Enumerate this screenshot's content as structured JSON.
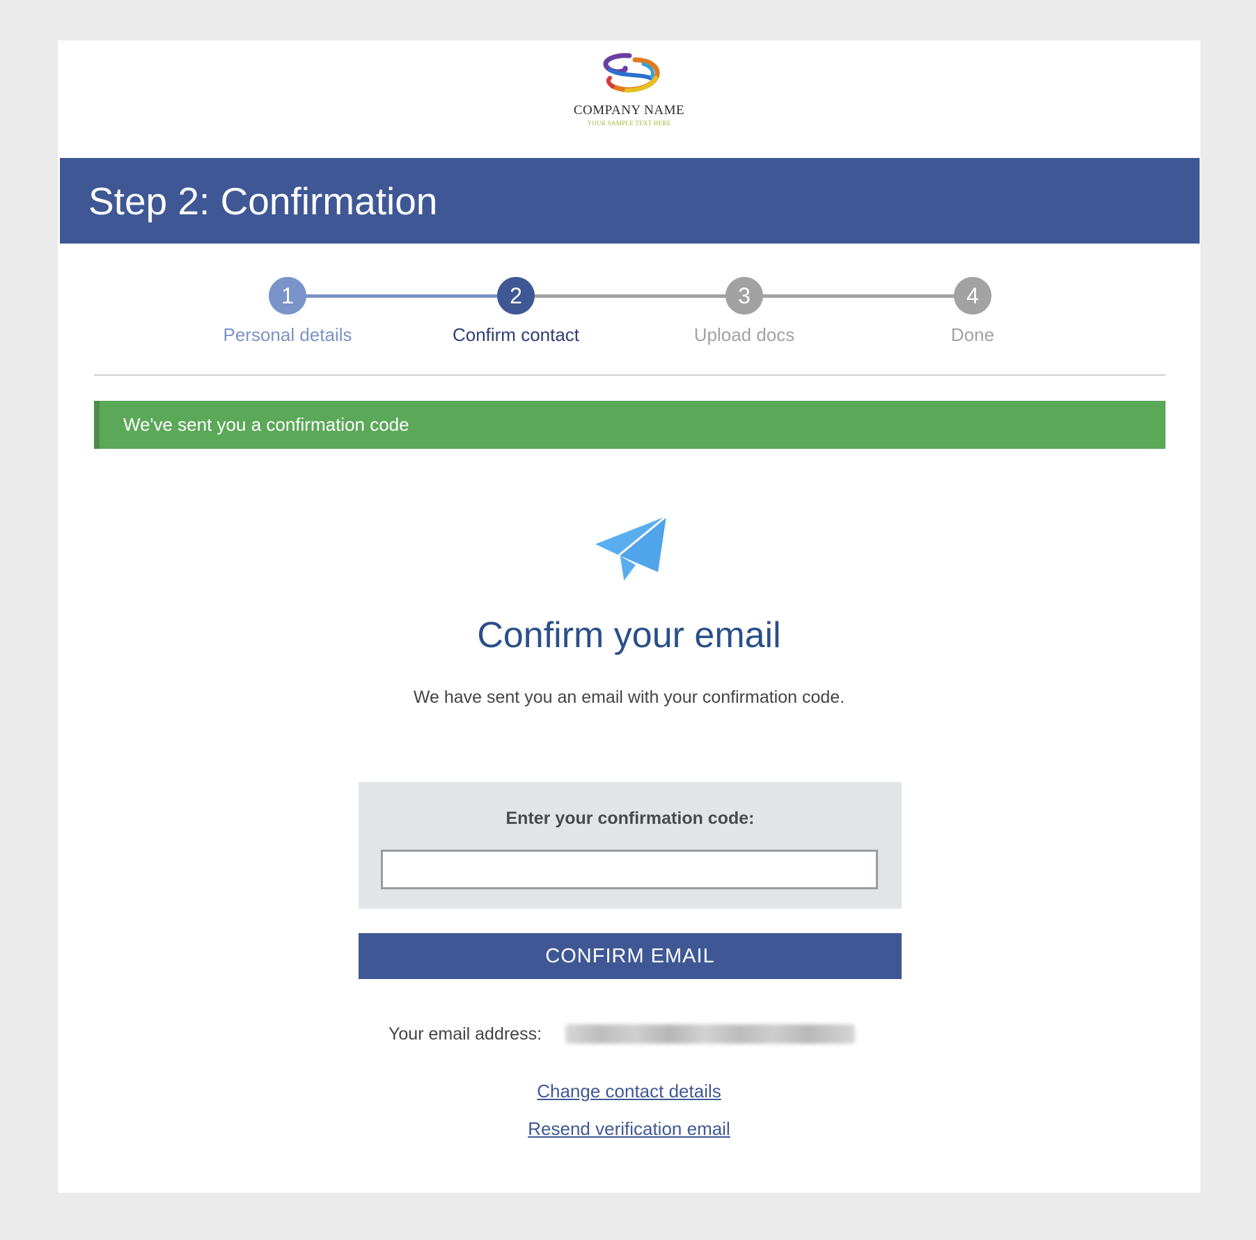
{
  "logo": {
    "name": "COMPANY NAME",
    "tagline": "YOUR SAMPLE TEXT HERE"
  },
  "header": {
    "title": "Step 2: Confirmation"
  },
  "stepper": {
    "steps": [
      {
        "number": "1",
        "label": "Personal details",
        "state": "completed"
      },
      {
        "number": "2",
        "label": "Confirm contact",
        "state": "active"
      },
      {
        "number": "3",
        "label": "Upload docs",
        "state": "pending"
      },
      {
        "number": "4",
        "label": "Done",
        "state": "pending"
      }
    ]
  },
  "alert": {
    "message": "We've sent you a confirmation code"
  },
  "main": {
    "icon": "paper-plane-icon",
    "title": "Confirm your email",
    "subtitle": "We have sent you an email with your confirmation code."
  },
  "code_form": {
    "label": "Enter your confirmation code:",
    "value": "",
    "placeholder": ""
  },
  "confirm_button": {
    "label": "CONFIRM EMAIL"
  },
  "email": {
    "label": "Your email address:"
  },
  "links": {
    "change_contact": "Change contact details",
    "resend": "Resend verification email"
  },
  "colors": {
    "primary": "#3f5895",
    "completed": "#7a93c8",
    "pending": "#a2a2a2",
    "success": "#5ba858",
    "title": "#2a4f8a",
    "icon": "#5aaef0",
    "background": "#ebebeb"
  }
}
